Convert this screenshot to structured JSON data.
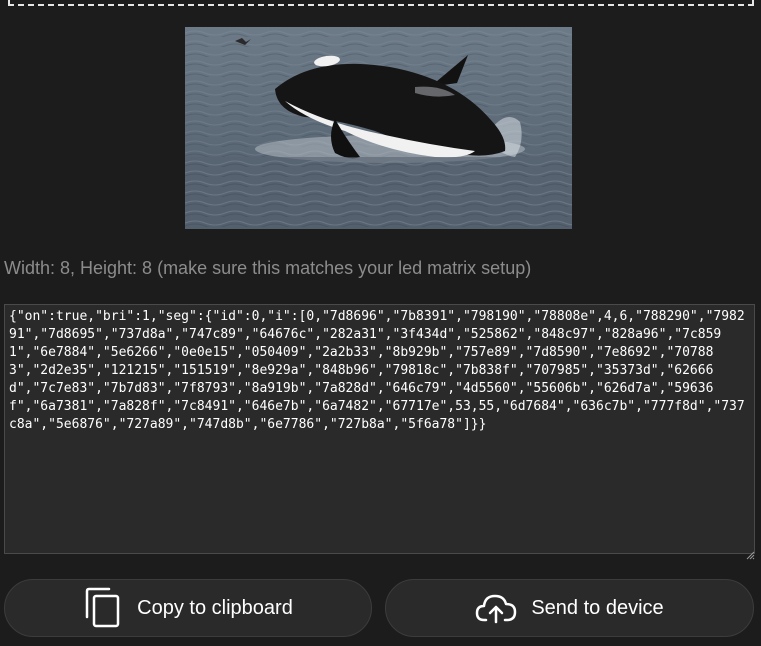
{
  "image": {
    "subject-icon": "orca-breaching-photo"
  },
  "size_info": "Width: 8, Height: 8 (make sure this matches your led matrix setup)",
  "json_output": "{\"on\":true,\"bri\":1,\"seg\":{\"id\":0,\"i\":[0,\"7d8696\",\"7b8391\",\"798190\",\"78808e\",4,6,\"788290\",\"798291\",\"7d8695\",\"737d8a\",\"747c89\",\"64676c\",\"282a31\",\"3f434d\",\"525862\",\"848c97\",\"828a96\",\"7c8591\",\"6e7884\",\"5e6266\",\"0e0e15\",\"050409\",\"2a2b33\",\"8b929b\",\"757e89\",\"7d8590\",\"7e8692\",\"707883\",\"2d2e35\",\"121215\",\"151519\",\"8e929a\",\"848b96\",\"79818c\",\"7b838f\",\"707985\",\"35373d\",\"62666d\",\"7c7e83\",\"7b7d83\",\"7f8793\",\"8a919b\",\"7a828d\",\"646c79\",\"4d5560\",\"55606b\",\"626d7a\",\"59636f\",\"6a7381\",\"7a828f\",\"7c8491\",\"646e7b\",\"6a7482\",\"67717e\",53,55,\"6d7684\",\"636c7b\",\"777f8d\",\"737c8a\",\"5e6876\",\"727a89\",\"747d8b\",\"6e7786\",\"727b8a\",\"5f6a78\"]}}",
  "buttons": {
    "copy_label": "Copy to clipboard",
    "copy_icon": "copy-icon",
    "send_label": "Send to device",
    "send_icon": "cloud-upload-icon"
  }
}
